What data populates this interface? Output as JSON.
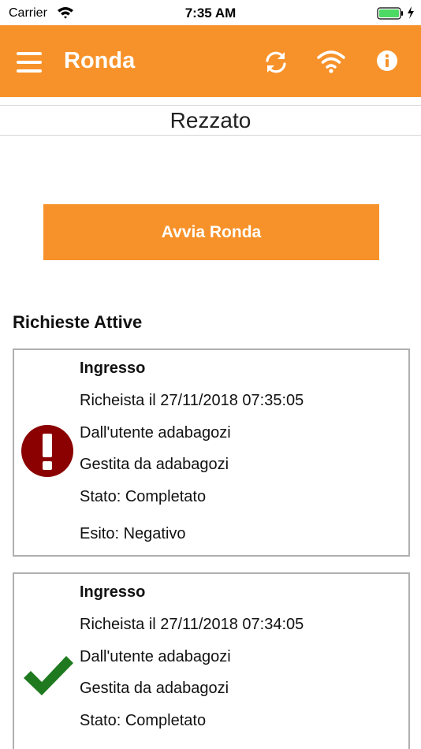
{
  "status_bar": {
    "carrier": "Carrier",
    "time": "7:35 AM",
    "battery_color": "#4cd964"
  },
  "nav": {
    "title": "Ronda",
    "background": "#f7922a",
    "icons": [
      "menu-icon",
      "sync-icon",
      "wifi-icon",
      "info-icon"
    ]
  },
  "location": {
    "name": "Rezzato"
  },
  "start_button": {
    "label": "Avvia Ronda"
  },
  "requests_section": {
    "title": "Richieste Attive",
    "items": [
      {
        "status_icon": "exclamation-icon",
        "icon_color": "#8b0000",
        "title": "Ingresso",
        "requested": "Richeista il 27/11/2018 07:35:05",
        "by_user": "Dall'utente adabagozi",
        "handled_by": "Gestita da adabagozi",
        "state": "Stato: Completato",
        "outcome": "Esito: Negativo"
      },
      {
        "status_icon": "checkmark-icon",
        "icon_color": "#1f7a1f",
        "title": "Ingresso",
        "requested": "Richeista il 27/11/2018 07:34:05",
        "by_user": "Dall'utente adabagozi",
        "handled_by": "Gestita da adabagozi",
        "state": "Stato: Completato"
      }
    ]
  }
}
